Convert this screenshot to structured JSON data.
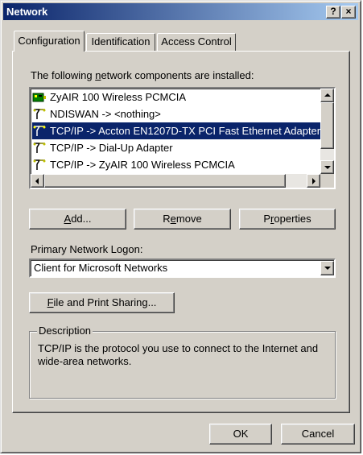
{
  "window": {
    "title": "Network",
    "help_glyph": "?",
    "close_glyph": "×"
  },
  "tabs": [
    {
      "label": "Configuration",
      "active": true
    },
    {
      "label": "Identification",
      "active": false
    },
    {
      "label": "Access Control",
      "active": false
    }
  ],
  "components": {
    "heading_pre": "The following ",
    "heading_accel": "n",
    "heading_post": "etwork components are installed:",
    "items": [
      {
        "label": "ZyAIR 100 Wireless PCMCIA",
        "icon": "network-adapter-icon",
        "selected": false
      },
      {
        "label": "NDISWAN -> <nothing>",
        "icon": "protocol-icon",
        "selected": false
      },
      {
        "label": "TCP/IP -> Accton EN1207D-TX PCI Fast Ethernet Adapter",
        "icon": "protocol-icon",
        "selected": true
      },
      {
        "label": "TCP/IP -> Dial-Up Adapter",
        "icon": "protocol-icon",
        "selected": false
      },
      {
        "label": "TCP/IP -> ZyAIR 100 Wireless PCMCIA",
        "icon": "protocol-icon",
        "selected": false
      }
    ]
  },
  "buttons": {
    "add_accel": "A",
    "add_rest": "dd...",
    "remove_pre": "R",
    "remove_accel": "e",
    "remove_post": "move",
    "properties_pre": "P",
    "properties_accel": "r",
    "properties_post": "operties",
    "file_print_accel": "F",
    "file_print_rest": "ile and Print Sharing...",
    "ok": "OK",
    "cancel": "Cancel"
  },
  "logon": {
    "label": "Primary Network Logon:",
    "value": "Client for Microsoft Networks"
  },
  "description": {
    "title": "Description",
    "text": "TCP/IP is the protocol you use to connect to the Internet and wide-area networks."
  },
  "colors": {
    "titlebar_start": "#0a246a",
    "titlebar_end": "#a6caf0",
    "selection": "#0a246a",
    "face": "#d4d0c8"
  }
}
